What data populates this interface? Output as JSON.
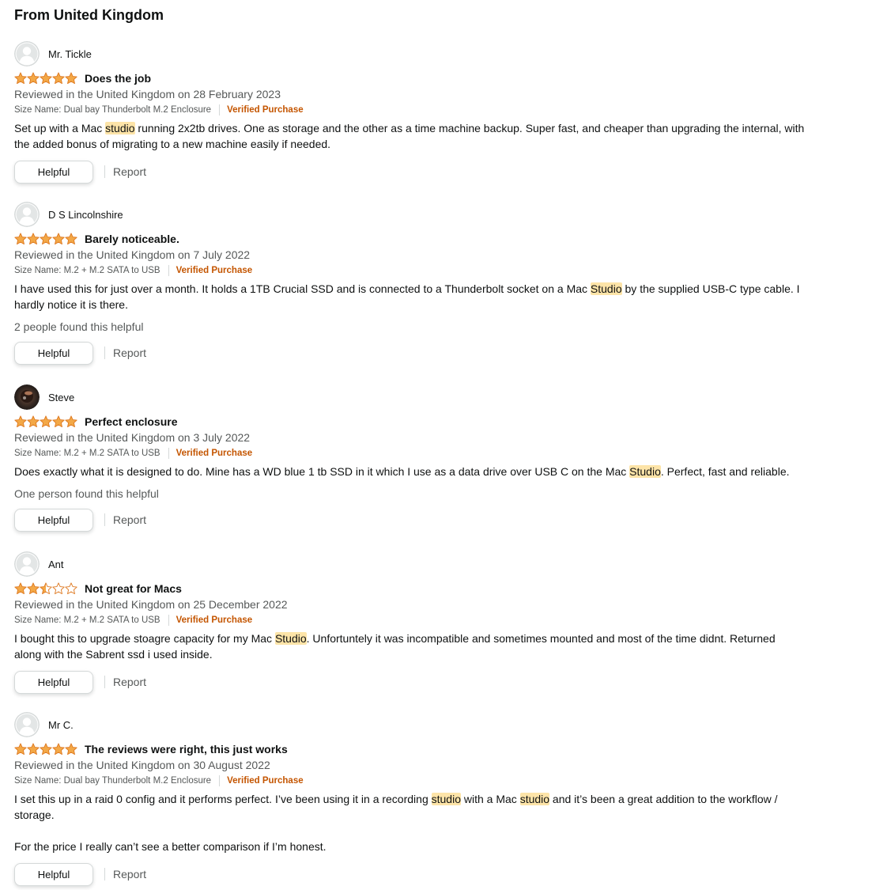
{
  "section": {
    "title": "From United Kingdom"
  },
  "colors": {
    "star": "#f3a847",
    "star_outline": "#de7921",
    "verified": "#c45500",
    "highlight": "#fde4a8"
  },
  "labels": {
    "helpful_button": "Helpful",
    "report_link": "Report",
    "verified_purchase": "Verified Purchase"
  },
  "reviews": [
    {
      "name": "Mr. Tickle",
      "avatar": "default-user-icon",
      "rating": 5,
      "rating_max": 5,
      "title": "Does the job",
      "date": "Reviewed in the United Kingdom on 28 February 2023",
      "format": "Size Name: Dual bay Thunderbolt M.2 Enclosure",
      "body": [
        [
          {
            "t": "Set up with a Mac "
          },
          {
            "t": "studio",
            "hl": true
          },
          {
            "t": " running 2x2tb drives. One as storage and the other as a time machine backup. Super fast, and cheaper than upgrading the internal, with the added bonus of migrating to a new machine easily if needed."
          }
        ]
      ],
      "helpful_stat": ""
    },
    {
      "name": "D S Lincolnshire",
      "avatar": "default-user-icon",
      "rating": 5,
      "rating_max": 5,
      "title": "Barely noticeable.",
      "date": "Reviewed in the United Kingdom on 7 July 2022",
      "format": "Size Name: M.2 + M.2 SATA to USB",
      "body": [
        [
          {
            "t": "I have used this for just over a month. It holds a 1TB Crucial SSD and is connected to a Thunderbolt socket on a Mac "
          },
          {
            "t": "Studio",
            "hl": true
          },
          {
            "t": " by the supplied USB-C type cable. I hardly notice it is there."
          }
        ]
      ],
      "helpful_stat": "2 people found this helpful"
    },
    {
      "name": "Steve",
      "avatar": "photo-avatar",
      "rating": 5,
      "rating_max": 5,
      "title": "Perfect enclosure",
      "date": "Reviewed in the United Kingdom on 3 July 2022",
      "format": "Size Name: M.2 + M.2 SATA to USB",
      "body": [
        [
          {
            "t": "Does exactly what it is designed to do. Mine has a WD blue 1 tb SSD in it which I use as a data drive over USB C on the Mac "
          },
          {
            "t": "Studio",
            "hl": true
          },
          {
            "t": ". Perfect, fast and reliable."
          }
        ]
      ],
      "helpful_stat": "One person found this helpful"
    },
    {
      "name": "Ant",
      "avatar": "default-user-icon",
      "rating": 2.5,
      "rating_max": 5,
      "title": "Not great for Macs",
      "date": "Reviewed in the United Kingdom on 25 December 2022",
      "format": "Size Name: M.2 + M.2 SATA to USB",
      "body": [
        [
          {
            "t": "I bought this to upgrade stoagre capacity for my Mac "
          },
          {
            "t": "Studio",
            "hl": true
          },
          {
            "t": ". Unfortuntely it was incompatible and sometimes mounted and most of the time didnt. Returned along with the Sabrent ssd i used inside."
          }
        ]
      ],
      "helpful_stat": ""
    },
    {
      "name": "Mr C.",
      "avatar": "default-user-icon",
      "rating": 5,
      "rating_max": 5,
      "title": "The reviews were right, this just works",
      "date": "Reviewed in the United Kingdom on 30 August 2022",
      "format": "Size Name: Dual bay Thunderbolt M.2 Enclosure",
      "body": [
        [
          {
            "t": "I set this up in a raid 0 config and it performs perfect. I’ve been using it in a recording "
          },
          {
            "t": "studio",
            "hl": true
          },
          {
            "t": " with a Mac "
          },
          {
            "t": "studio",
            "hl": true
          },
          {
            "t": " and it’s been a great addition to the workflow / storage."
          }
        ],
        [
          {
            "t": "For the price I really can’t see a better comparison if I’m honest."
          }
        ]
      ],
      "helpful_stat": ""
    }
  ]
}
